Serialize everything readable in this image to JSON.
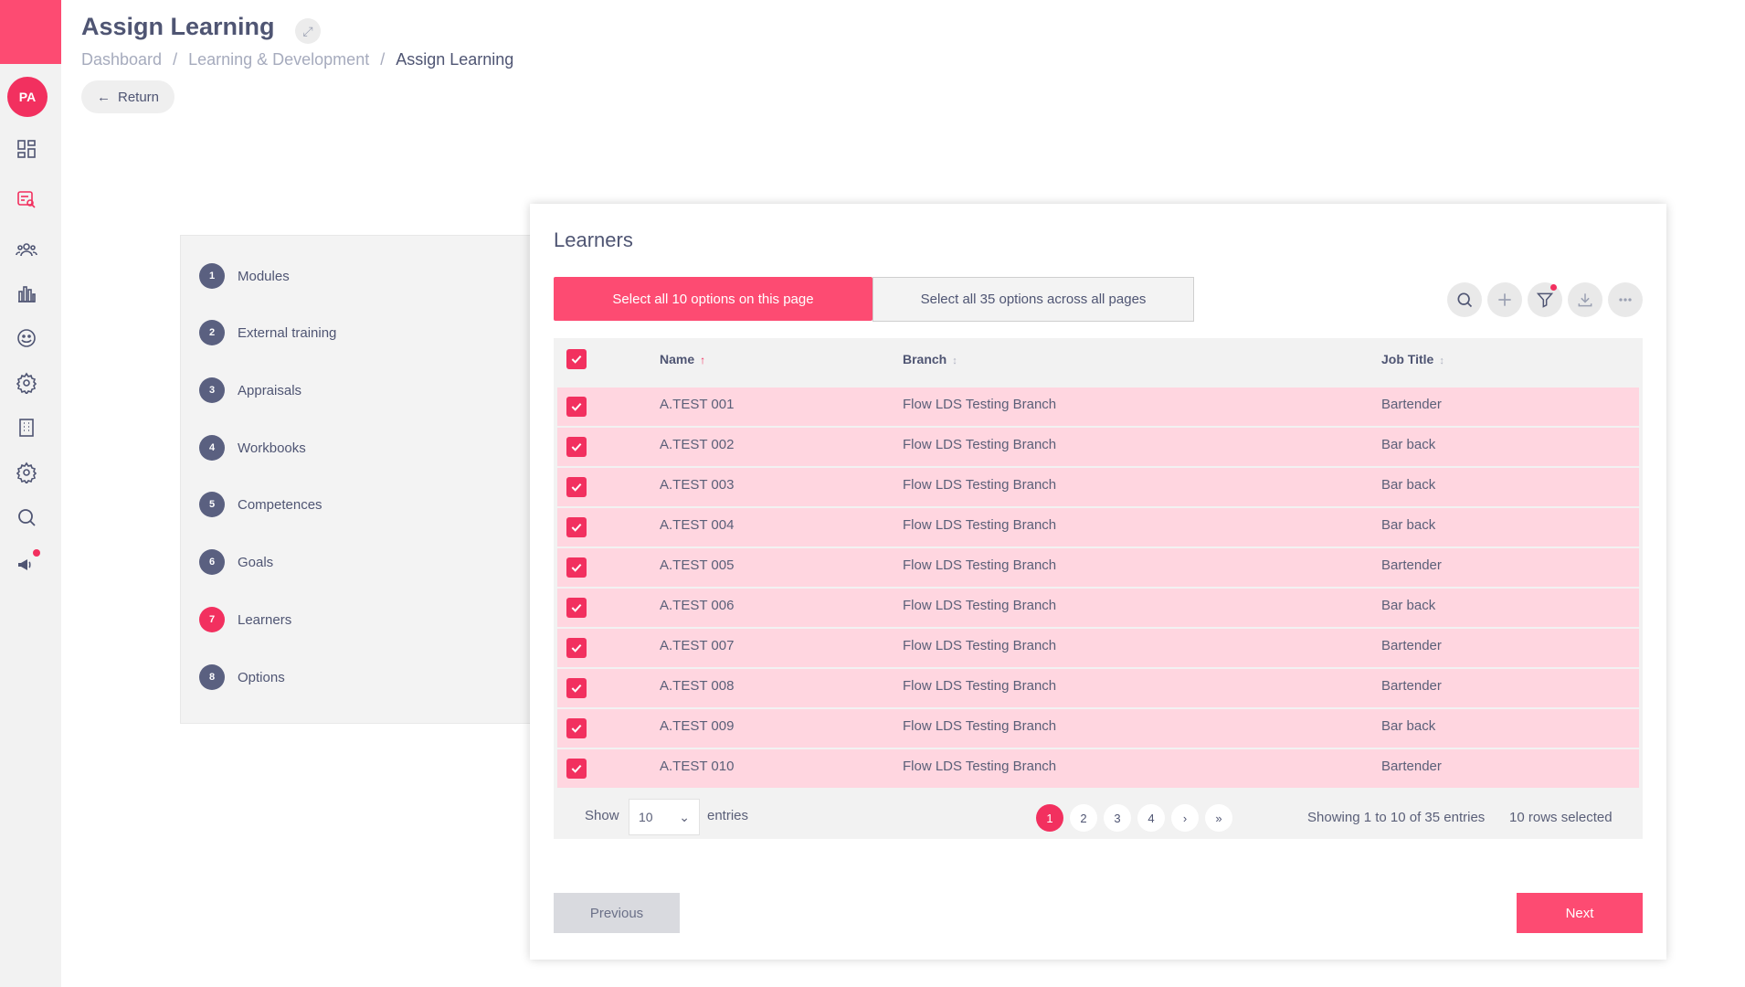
{
  "header": {
    "title": "Assign Learning",
    "breadcrumb": [
      "Dashboard",
      "Learning & Development",
      "Assign Learning"
    ],
    "return_label": "Return"
  },
  "user": {
    "initials": "PA"
  },
  "steps": [
    {
      "num": "1",
      "label": "Modules"
    },
    {
      "num": "2",
      "label": "External training"
    },
    {
      "num": "3",
      "label": "Appraisals"
    },
    {
      "num": "4",
      "label": "Workbooks"
    },
    {
      "num": "5",
      "label": "Competences"
    },
    {
      "num": "6",
      "label": "Goals"
    },
    {
      "num": "7",
      "label": "Learners"
    },
    {
      "num": "8",
      "label": "Options"
    }
  ],
  "card": {
    "title": "Learners",
    "select_page_label": "Select all 10 options on this page",
    "select_all_label": "Select all 35 options across all pages"
  },
  "table": {
    "columns": [
      "Name",
      "Branch",
      "Job Title"
    ],
    "rows": [
      {
        "name": "A.TEST 001",
        "branch": "Flow LDS Testing Branch",
        "job": "Bartender"
      },
      {
        "name": "A.TEST 002",
        "branch": "Flow LDS Testing Branch",
        "job": "Bar back"
      },
      {
        "name": "A.TEST 003",
        "branch": "Flow LDS Testing Branch",
        "job": "Bar back"
      },
      {
        "name": "A.TEST 004",
        "branch": "Flow LDS Testing Branch",
        "job": "Bar back"
      },
      {
        "name": "A.TEST 005",
        "branch": "Flow LDS Testing Branch",
        "job": "Bartender"
      },
      {
        "name": "A.TEST 006",
        "branch": "Flow LDS Testing Branch",
        "job": "Bar back"
      },
      {
        "name": "A.TEST 007",
        "branch": "Flow LDS Testing Branch",
        "job": "Bartender"
      },
      {
        "name": "A.TEST 008",
        "branch": "Flow LDS Testing Branch",
        "job": "Bartender"
      },
      {
        "name": "A.TEST 009",
        "branch": "Flow LDS Testing Branch",
        "job": "Bar back"
      },
      {
        "name": "A.TEST 010",
        "branch": "Flow LDS Testing Branch",
        "job": "Bartender"
      }
    ]
  },
  "footer": {
    "show_label": "Show",
    "entries_value": "10",
    "entries_label": "entries",
    "pages": [
      "1",
      "2",
      "3",
      "4",
      "›",
      "»"
    ],
    "showing": "Showing 1 to 10 of 35 entries",
    "selected": "10 rows selected"
  },
  "actions": {
    "previous": "Previous",
    "next": "Next"
  },
  "colors": {
    "accent": "#fd4b72",
    "row_selected": "#ffd6e0",
    "step_inactive": "#5a6080"
  }
}
